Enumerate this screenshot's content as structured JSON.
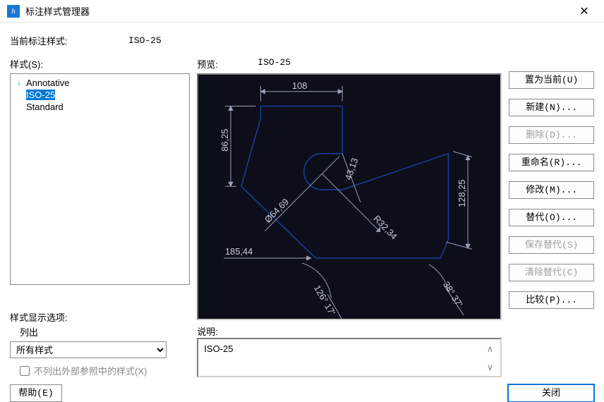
{
  "window": {
    "title": "标注样式管理器"
  },
  "current": {
    "label": "当前标注样式:",
    "value": "ISO-25"
  },
  "styles": {
    "label": "样式(S):",
    "list": [
      {
        "name": "Annotative",
        "icon": true,
        "selected": false
      },
      {
        "name": "ISO-25",
        "icon": false,
        "selected": true
      },
      {
        "name": "Standard",
        "icon": false,
        "selected": false
      }
    ]
  },
  "display_options": {
    "label": "样式显示选项:",
    "sublabel": "列出",
    "select_value": "所有样式",
    "checkbox_label": "不列出外部参照中的样式(X)",
    "checkbox_checked": false
  },
  "preview": {
    "label": "预览:",
    "value": "ISO-25",
    "dims": {
      "top": "108",
      "left": "86,25",
      "right": "128,25",
      "radius": "R32,34",
      "diam": "Ø64,69",
      "inner": "43,13",
      "hlen": "185,44",
      "ang1": "126° 17'",
      "ang2": "38° 37'"
    }
  },
  "description": {
    "label": "说明:",
    "text": "ISO-25"
  },
  "buttons": {
    "set_current": "置为当前(U)",
    "new": "新建(N)...",
    "delete": "删除(D)...",
    "rename": "重命名(R)...",
    "modify": "修改(M)...",
    "override": "替代(O)...",
    "save_override": "保存替代(S)",
    "clear_override": "清除替代(C)",
    "compare": "比较(P)...",
    "help": "帮助(E)",
    "close": "关闭"
  }
}
